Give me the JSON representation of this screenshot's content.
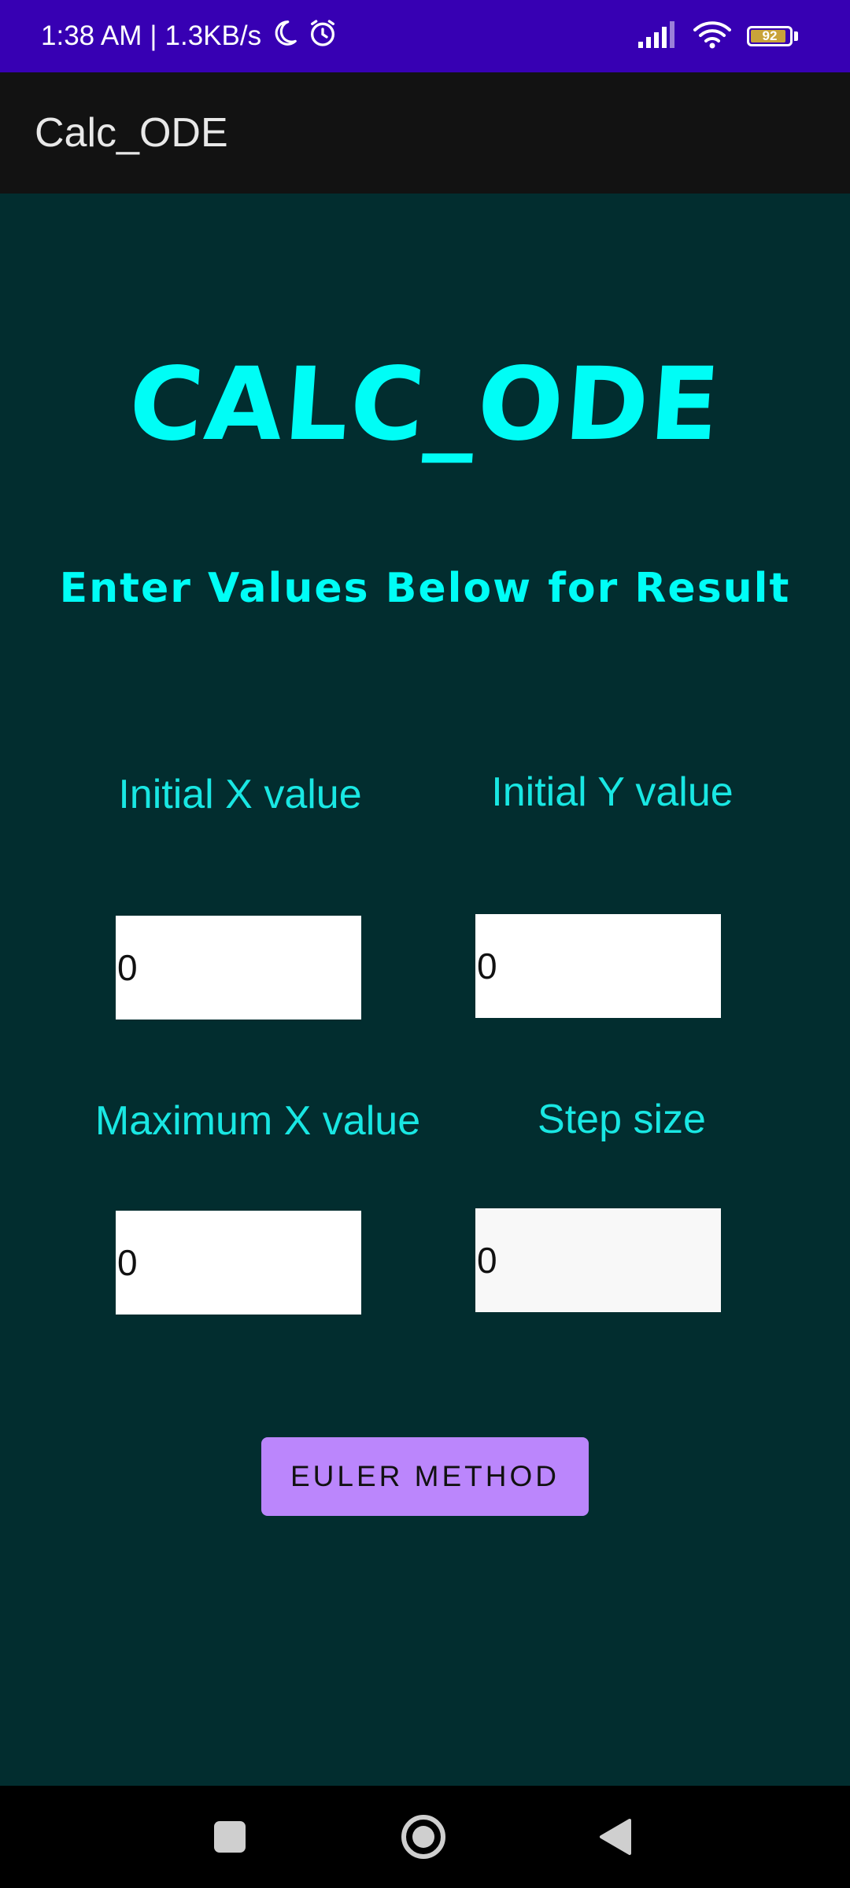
{
  "status_bar": {
    "time": "1:38 AM",
    "separator": "|",
    "speed": "1.3KB/s",
    "moon_icon": "moon-icon",
    "alarm_icon": "alarm-icon",
    "battery_level": "92"
  },
  "app_bar": {
    "title": "Calc_ODE"
  },
  "main": {
    "logo": "CALC_ODE",
    "subtitle": "Enter Values Below for Result",
    "fields": {
      "initial_x": {
        "label": "Initial X value",
        "value": "0"
      },
      "initial_y": {
        "label": "Initial Y value",
        "value": "0"
      },
      "max_x": {
        "label": "Maximum X value",
        "value": "0"
      },
      "step_size": {
        "label": "Step size",
        "value": "0"
      }
    },
    "button_label": "EULER METHOD"
  },
  "colors": {
    "status_bar": "#3700b3",
    "app_bar": "#121212",
    "background": "#022d2f",
    "accent_text": "#00fdf6",
    "button": "#bb86fc"
  }
}
